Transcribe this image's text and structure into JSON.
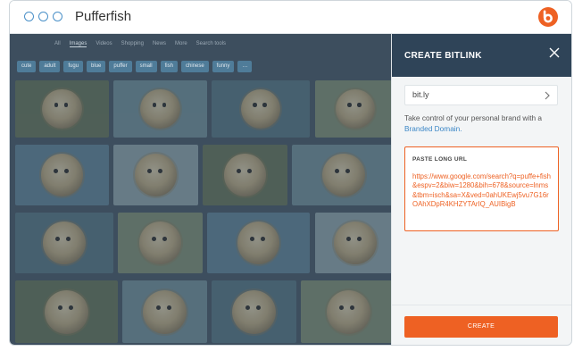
{
  "window": {
    "title": "Pufferfish",
    "logo_icon": "bitly-logo-icon",
    "dots_icon": "window-dot-icon"
  },
  "google": {
    "tabs": [
      "All",
      "Images",
      "Videos",
      "Shopping",
      "News",
      "More",
      "Search tools"
    ],
    "active_tab": "Images",
    "chips": [
      "cute",
      "adult",
      "fugu",
      "blue",
      "puffer",
      "small",
      "fish",
      "chinese",
      "funny",
      "…"
    ],
    "thumb_colors": [
      "#5e6d52",
      "#6b8a96",
      "#4f6f7e",
      "#7a8a70",
      "#5a7e94",
      "#8aa0a8"
    ]
  },
  "panel": {
    "title": "CREATE BITLINK",
    "close_icon": "close-icon",
    "domain_value": "bit.ly",
    "chevron_icon": "chevron-right-icon",
    "promo_text": "Take control of your personal brand with a",
    "promo_link": "Branded Domain.",
    "paste_label": "PASTE LONG URL",
    "long_url": "https://www.google.com/search?q=puffe+fish&espv=2&biw=1280&bih=678&source=lnms&tbm=isch&sa=X&ved=0ahUKEwj5vu7G16rOAhXDpR4KHZYTArIQ_AUIBigB",
    "create_label": "CREATE",
    "accent": "#ee6123",
    "header_bg": "#2f4458"
  }
}
